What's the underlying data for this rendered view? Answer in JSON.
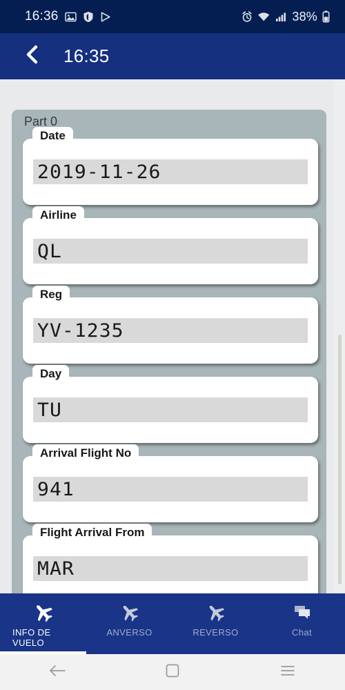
{
  "status_bar": {
    "clock": "16:36",
    "battery_text": "38%",
    "left_icons": [
      "image-icon",
      "shield-icon",
      "play-arrow-icon"
    ],
    "right_icons": [
      "alarm-clock-icon",
      "wifi-icon",
      "signal-bars-icon",
      "battery-icon"
    ]
  },
  "app_bar": {
    "back_icon": "chevron-left-icon",
    "title": "16:35"
  },
  "form": {
    "part_title": "Part 0",
    "fields": [
      {
        "label": "Date",
        "value": "2019-11-26"
      },
      {
        "label": "Airline",
        "value": "QL"
      },
      {
        "label": "Reg",
        "value": "YV-1235"
      },
      {
        "label": "Day",
        "value": "TU"
      },
      {
        "label": "Arrival Flight No",
        "value": "941"
      },
      {
        "label": "Flight Arrival From",
        "value": "MAR"
      }
    ]
  },
  "tabs": [
    {
      "label": "INFO DE\nVUELO",
      "icon": "airplane-icon",
      "active": true
    },
    {
      "label": "ANVERSO",
      "icon": "airplane-icon",
      "active": false
    },
    {
      "label": "REVERSO",
      "icon": "airplane-icon",
      "active": false
    },
    {
      "label": "Chat",
      "icon": "chat-bubbles-icon",
      "active": false
    }
  ],
  "android_nav": {
    "back": "back-arrow-icon",
    "home": "home-square-icon",
    "recents": "recents-menu-icon"
  },
  "colors": {
    "status_bar": "#041e52",
    "app_bar": "#15307f",
    "tab_bar": "#1a3487",
    "page_bg": "#e9eaec",
    "panel_bg": "#a9b6b9",
    "value_bg": "#d9d9d9",
    "accent": "#ffffff"
  }
}
